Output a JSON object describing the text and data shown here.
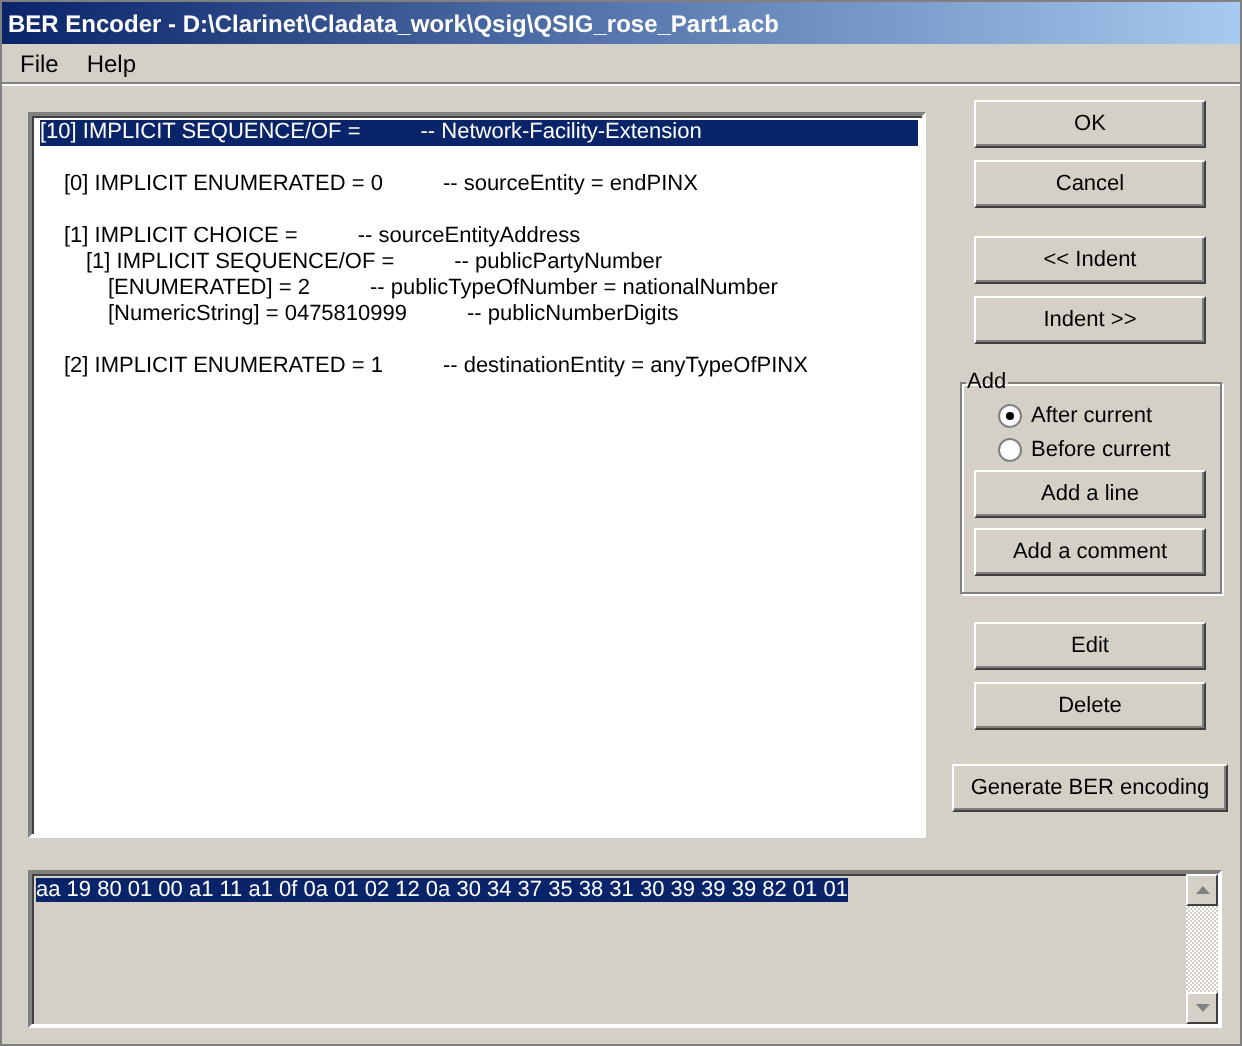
{
  "window": {
    "title": "BER Encoder - D:\\Clarinet\\Cladata_work\\Qsig\\QSIG_rose_Part1.acb"
  },
  "menu": [
    "File",
    "Help"
  ],
  "tree": [
    {
      "code": "[10] IMPLICIT SEQUENCE/OF =",
      "comment": "-- Network-Facility-Extension",
      "selected": true,
      "children": [
        {
          "code": "[0] IMPLICIT ENUMERATED = 0",
          "comment": "-- sourceEntity = endPINX",
          "selected": false
        },
        {
          "code": "[1] IMPLICIT CHOICE =",
          "comment": "-- sourceEntityAddress",
          "selected": false,
          "children": [
            {
              "code": "[1] IMPLICIT SEQUENCE/OF =",
              "comment": "-- publicPartyNumber",
              "selected": false,
              "children": [
                {
                  "code": "[ENUMERATED] = 2",
                  "comment": "-- publicTypeOfNumber = nationalNumber",
                  "selected": false
                },
                {
                  "code": "[NumericString] = 0475810999",
                  "comment": "-- publicNumberDigits",
                  "selected": false
                }
              ]
            }
          ]
        },
        {
          "code": "[2] IMPLICIT ENUMERATED = 1",
          "comment": "-- destinationEntity = anyTypeOfPINX",
          "selected": false
        }
      ]
    }
  ],
  "buttons_top": [
    "OK",
    "Cancel"
  ],
  "buttons_indent": [
    "<< Indent",
    "Indent >>"
  ],
  "add_group": {
    "title": "Add",
    "options": [
      {
        "label": "After current",
        "selected": true
      },
      {
        "label": "Before current",
        "selected": false
      }
    ],
    "buttons": [
      "Add a line",
      "Add a comment"
    ]
  },
  "buttons_edit": [
    "Edit",
    "Delete"
  ],
  "generate_button": "Generate BER encoding",
  "encoding": {
    "text": "aa 19 80 01 00 a1 11 a1 0f 0a 01 02 12 0a 30 34 37 35 38 31 30 39 39 39 82 01 01",
    "selected": true
  }
}
